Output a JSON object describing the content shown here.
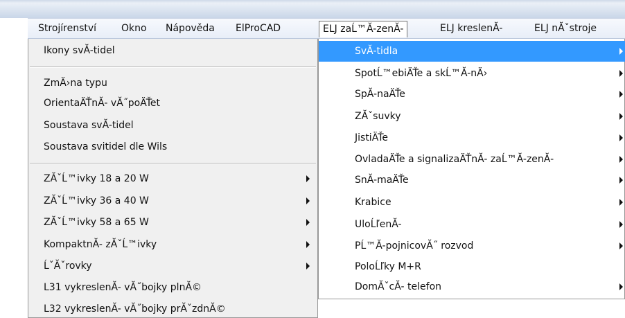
{
  "menubar": {
    "items": [
      "Strojírenství",
      "Okno",
      "Nápověda",
      "ElProCAD",
      "ELJ zaĹ™Ă-zenĂ-",
      "ELJ kreslenĂ-",
      "ELJ nĂˇstroje"
    ],
    "active": "ELJ zaĹ™Ă-zenĂ-"
  },
  "dropdown": {
    "items": [
      "Ikony svĂ-tidel",
      "ZmÄ›na typu",
      "OrientaÄŤnĂ- vĂ˝poÄŤet",
      "Soustava svĂ-tidel",
      "Soustava svitidel dle Wils",
      "ZĂˇĹ™ivky 18 a 20 W",
      "ZĂˇĹ™ivky 36 a 40 W",
      "ZĂˇĹ™ivky 58 a 65 W",
      "KompaktnĂ- zĂˇĹ™ivky",
      "ĹˇĂˇrovky",
      "L31 vykreslenĂ- vĂ˝bojky plnĂ©",
      "L32 vykreslenĂ- vĂ˝bojky prĂˇzdnĂ©"
    ]
  },
  "submenu": {
    "highlight_color": "#3399ff",
    "items": [
      "SvĂ-tidla",
      "SpotĹ™ebiÄŤe a skĹ™Ă-nÄ›",
      "SpĂ-naÄŤe",
      "ZĂˇsuvky",
      "JistiÄŤe",
      "OvladaÄŤe a signalizaÄŤnĂ- zaĹ™Ă-zenĂ-",
      "SnĂ-maÄŤe",
      "Krabice",
      "UloĹľenĂ-",
      "PĹ™Ă-pojnicovĂ˝ rozvod",
      "PoloĹľky M+R",
      "DomĂˇcĂ- telefon"
    ]
  }
}
